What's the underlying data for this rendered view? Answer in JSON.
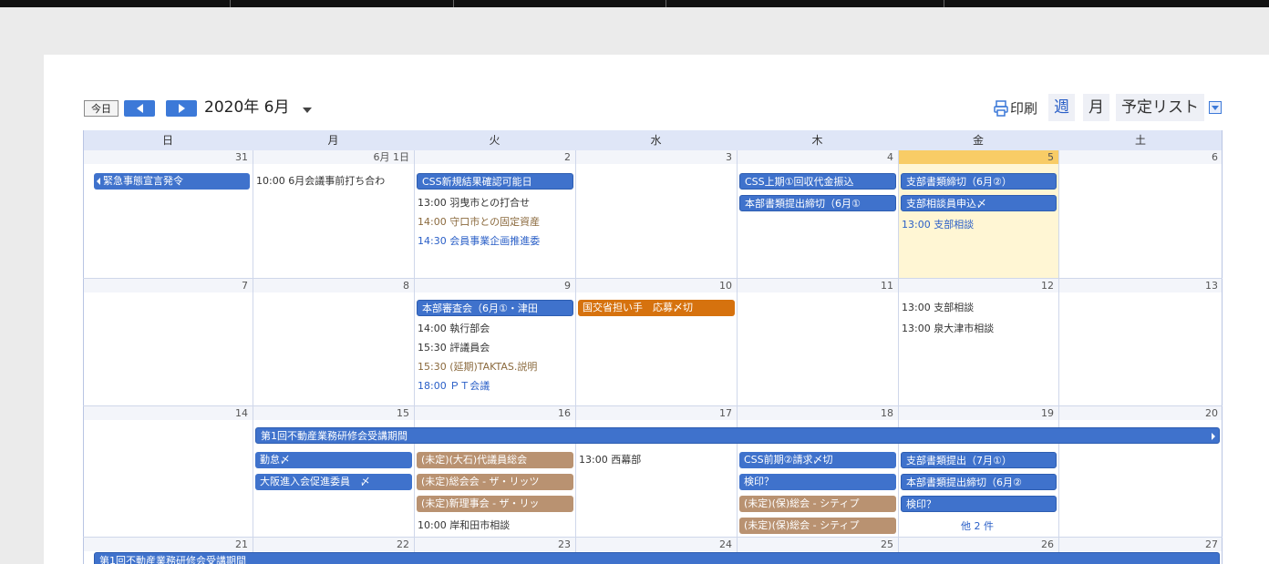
{
  "toolbar": {
    "today_label": "今日",
    "month_title": "2020年 6月",
    "print_label": "印刷",
    "view_week": "週",
    "view_month": "月",
    "view_list": "予定リスト",
    "icons": [
      "chevron-left-icon",
      "chevron-right-icon",
      "caret-down-icon",
      "printer-icon"
    ]
  },
  "weekdays": [
    "日",
    "月",
    "火",
    "水",
    "木",
    "金",
    "土"
  ],
  "weeks": [
    {
      "days": [
        "31",
        "6月 1日",
        "2",
        "3",
        "4",
        "5",
        "6"
      ]
    },
    {
      "days": [
        "7",
        "8",
        "9",
        "10",
        "11",
        "12",
        "13"
      ]
    },
    {
      "days": [
        "14",
        "15",
        "16",
        "17",
        "18",
        "19",
        "20"
      ]
    },
    {
      "days": [
        "21",
        "22",
        "23",
        "24",
        "25",
        "26",
        "27"
      ]
    }
  ],
  "events": {
    "w1": {
      "sun_allday": "緊急事態宣言発令",
      "mon_timed": "10:00 6月会議事前打ち合わ",
      "tue_allday": "CSS新規結果確認可能日",
      "tue_timed": [
        "13:00 羽曳市との打合せ",
        "14:00 守口市との固定資産",
        "14:30 会員事業企画推進委"
      ],
      "thu_allday": [
        "CSS上期①回収代金振込",
        "本部書類提出締切（6月①"
      ],
      "fri_allday": [
        "支部書類締切（6月②）",
        "支部相談員申込〆"
      ],
      "fri_timed": "13:00 支部相談"
    },
    "w2": {
      "tue_allday": "本部審査会（6月①・津田",
      "wed_allday": "国交省担い手　応募〆切",
      "tue_timed": [
        "14:00 執行部会",
        "15:30 評議員会",
        "15:30 (延期)TAKTAS.説明",
        "18:00 ＰＴ会議"
      ],
      "fri_timed": [
        "13:00 支部相談",
        "13:00 泉大津市相談"
      ]
    },
    "w3": {
      "span": "第1回不動産業務研修会受講期間",
      "mon": [
        "勤怠〆",
        "大阪進入会促進委員　〆"
      ],
      "tue": [
        "(未定)(大石)代議員総会",
        "(未定)総会会 - ザ・リッツ",
        "(未定)新理事会 - ザ・リッ",
        "10:00 岸和田市相談"
      ],
      "wed_timed": "13:00 西幕部",
      "thu": [
        "CSS前期②請求〆切",
        "検印？",
        "(未定)(保)総会 - シティプ",
        "(未定)(保)総会 - シティプ"
      ],
      "fri": [
        "支部書類提出（7月①）",
        "本部書類提出締切（6月②",
        "検印？"
      ],
      "fri_more": "他 2 件"
    },
    "w4": {
      "span": "第1回不動産業務研修会受講期間"
    }
  }
}
